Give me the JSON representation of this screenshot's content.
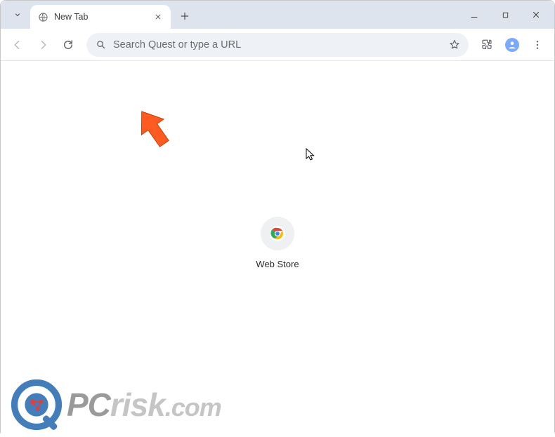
{
  "tab": {
    "title": "New Tab"
  },
  "omnibox": {
    "placeholder": "Search Quest or type a URL"
  },
  "shortcuts": [
    {
      "label": "Web Store"
    }
  ],
  "watermark": {
    "pc": "PC",
    "risk": "risk",
    "com": ".com"
  },
  "colors": {
    "accent_arrow": "#ff5a1f",
    "tabstrip": "#dde4ee",
    "omnibox_bg": "#eef1f6"
  },
  "icons": {
    "tab_search": "chevron-down-icon",
    "favicon": "globe-icon",
    "close": "close-icon",
    "new_tab": "plus-icon",
    "minimize": "minimize-icon",
    "maximize": "maximize-icon",
    "win_close": "close-icon",
    "back": "arrow-left-icon",
    "forward": "arrow-right-icon",
    "reload": "reload-icon",
    "search": "search-icon",
    "bookmark": "star-icon",
    "extensions": "puzzle-icon",
    "profile": "profile-icon",
    "menu": "kebab-icon",
    "web_store": "chrome-logo-icon"
  }
}
